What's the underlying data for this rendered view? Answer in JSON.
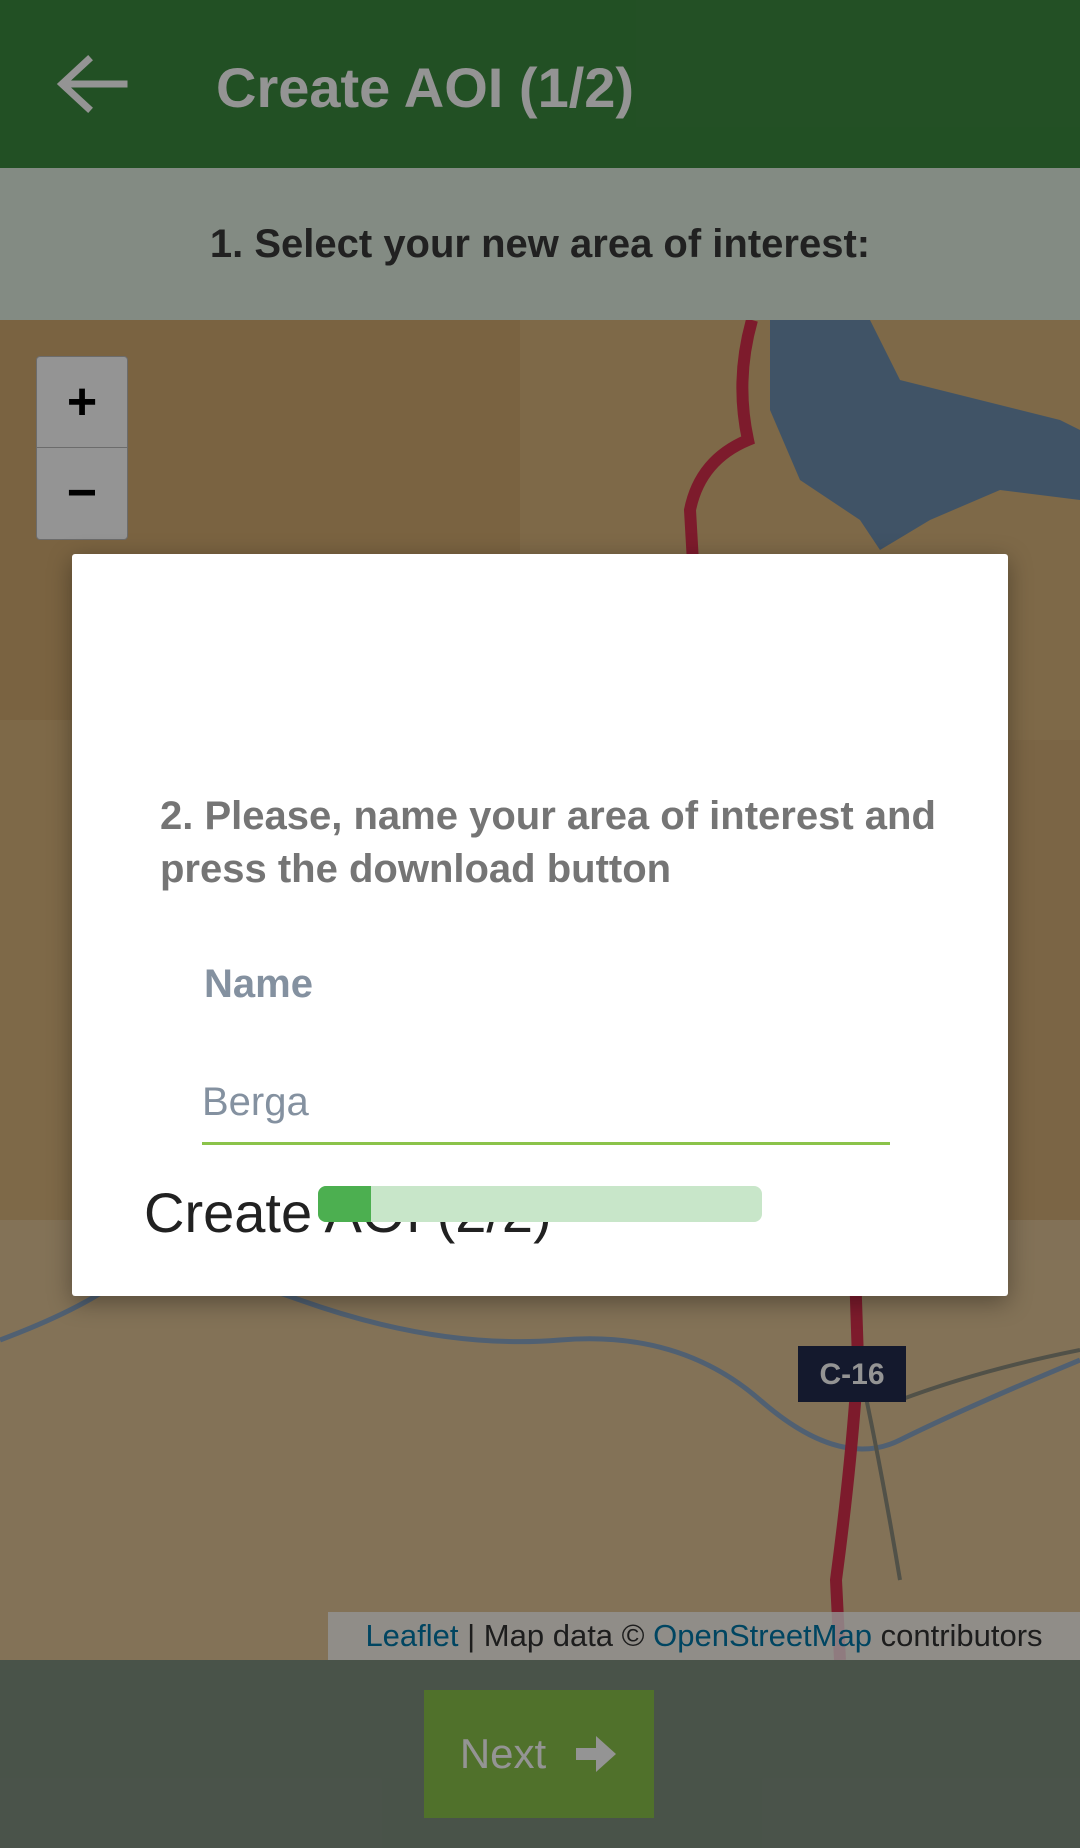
{
  "appbar": {
    "title": "Create AOI (1/2)",
    "back_icon": "arrow-left-icon"
  },
  "step": {
    "text": "1. Select your new area of interest:"
  },
  "map": {
    "zoom_in": "+",
    "zoom_out": "−",
    "road_label": "C-16",
    "attribution": {
      "leaflet": "Leaflet",
      "separator": " | Map data © ",
      "osm": "OpenStreetMap",
      "contributors": " contributors"
    }
  },
  "footer": {
    "next_label": "Next",
    "next_icon": "arrow-right-icon"
  },
  "dialog": {
    "title": "Create AOI (2/2)",
    "description": "2. Please, name your area of interest and press the download button",
    "name_label": "Name",
    "name_value": "Berga",
    "progress": 0.12
  },
  "colors": {
    "primary": "#3c8a3f",
    "accent": "#8bc34a",
    "progress": "#4caf50",
    "progress_track": "#c8e6c9"
  }
}
